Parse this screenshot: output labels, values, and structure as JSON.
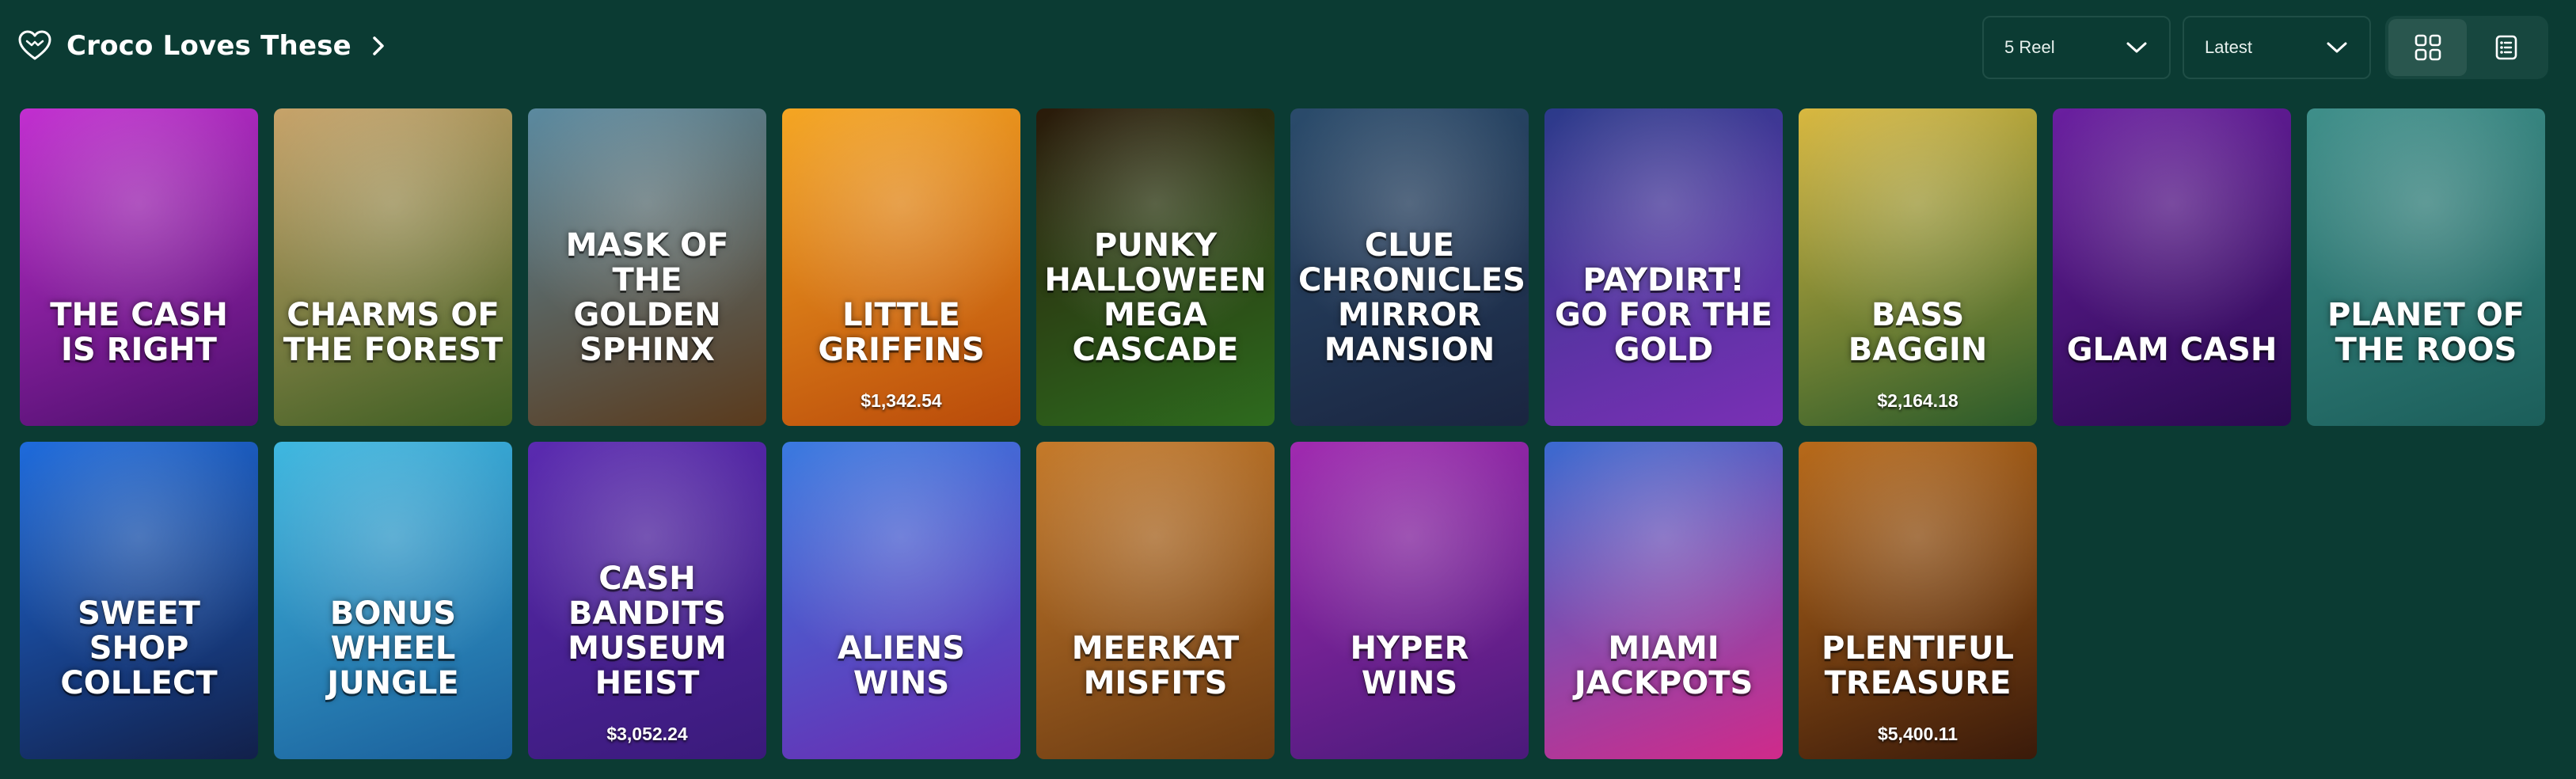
{
  "header": {
    "title": "Croco Loves These",
    "title_icon": "heart-outline-icon",
    "title_arrow_icon": "chevron-right-icon"
  },
  "filters": {
    "reel": {
      "value": "5 Reel",
      "icon": "chevron-down-icon"
    },
    "sort": {
      "value": "Latest",
      "icon": "chevron-down-icon"
    }
  },
  "view_toggle": {
    "grid_icon": "grid-view-icon",
    "list_icon": "list-view-icon",
    "active": "grid"
  },
  "colors": {
    "page_background": "#0b3b33",
    "border": "#1f4e46",
    "toggle_background": "#17473f",
    "toggle_active": "#29564e"
  },
  "games": [
    {
      "name": "The Cash is Right",
      "jackpot": "",
      "bg": [
        "#c22fd0",
        "#4b0f6b"
      ]
    },
    {
      "name": "Charms of the Forest",
      "jackpot": "",
      "bg": [
        "#c7a36a",
        "#3d5e22"
      ]
    },
    {
      "name": "Mask of the Golden Sphinx",
      "jackpot": "",
      "bg": [
        "#5b8aa0",
        "#5a3a1c"
      ]
    },
    {
      "name": "Little Griffins",
      "jackpot": "$1,342.54",
      "bg": [
        "#f5a623",
        "#b94a0a"
      ]
    },
    {
      "name": "Punky Halloween Mega Cascade",
      "jackpot": "",
      "bg": [
        "#2a1a0a",
        "#2d6b1e"
      ]
    },
    {
      "name": "Clue Chronicles Mirror Mansion",
      "jackpot": "",
      "bg": [
        "#2a4b6b",
        "#1a2540"
      ]
    },
    {
      "name": "Paydirt! Go for the Gold",
      "jackpot": "",
      "bg": [
        "#2b3a8a",
        "#7a2fb5"
      ]
    },
    {
      "name": "Bass Baggin",
      "jackpot": "$2,164.18",
      "bg": [
        "#d9b840",
        "#2a5a2a"
      ]
    },
    {
      "name": "Glam Cash",
      "jackpot": "",
      "bg": [
        "#6a1fa0",
        "#2a0a50"
      ]
    },
    {
      "name": "Planet of the Roos",
      "jackpot": "",
      "bg": [
        "#3f8f8a",
        "#1b5e5a"
      ]
    },
    {
      "name": "Sweet Shop Collect",
      "jackpot": "",
      "bg": [
        "#1e6bdc",
        "#12204a"
      ]
    },
    {
      "name": "Bonus Wheel Jungle",
      "jackpot": "",
      "bg": [
        "#3fb8e0",
        "#1a5e9a"
      ]
    },
    {
      "name": "Cash Bandits Museum Heist",
      "jackpot": "$3,052.24",
      "bg": [
        "#5a2ab0",
        "#3a1a7a"
      ]
    },
    {
      "name": "Aliens Wins",
      "jackpot": "",
      "bg": [
        "#3a7ae0",
        "#6a2ab0"
      ]
    },
    {
      "name": "Meerkat Misfits",
      "jackpot": "",
      "bg": [
        "#c57a2a",
        "#6a3a12"
      ]
    },
    {
      "name": "Hyper Wins",
      "jackpot": "",
      "bg": [
        "#a02ab0",
        "#4a1a7a"
      ]
    },
    {
      "name": "Miami Jackpots",
      "jackpot": "",
      "bg": [
        "#3a6ad0",
        "#d02a8a"
      ]
    },
    {
      "name": "Plentiful Treasure",
      "jackpot": "$5,400.11",
      "bg": [
        "#b86a1a",
        "#3a1a0a"
      ]
    }
  ]
}
